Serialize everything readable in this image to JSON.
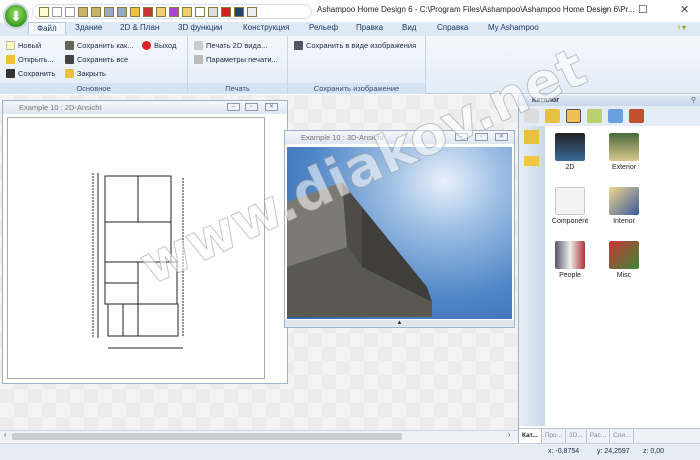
{
  "window": {
    "title": "Ashampoo Home Design 6 - C:\\Program Files\\Ashampoo\\Ashampoo Home Design 6\\Pr...",
    "minimize": "–",
    "maximize": "☐",
    "close": "✕"
  },
  "tabs": [
    "Файл",
    "Здание",
    "2D & План",
    "3D функции",
    "Конструкция",
    "Рельеф",
    "Правка",
    "Вид",
    "Справка",
    "My Ashampoo"
  ],
  "ribbon": {
    "groups": [
      {
        "label": "Основное",
        "items": [
          "Новый",
          "Открыть...",
          "Сохранить",
          "Сохранить как...",
          "Сохранить все",
          "Закрыть",
          "Выход"
        ]
      },
      {
        "label": "Печать",
        "items": [
          "Печать 2D вида...",
          "Параметры печати..."
        ]
      },
      {
        "label": "Сохранить изображение",
        "items": [
          "Сохранить в виде изображения"
        ]
      }
    ]
  },
  "windows": {
    "view2d": "Example 10 : 2D-Ansicht",
    "view3d": "Example 10 : 3D-Ansicht"
  },
  "catalog": {
    "title": "Каталог",
    "items": [
      "2D",
      "Exterior",
      "Component",
      "Interior",
      "People",
      "Misc"
    ],
    "tabs": [
      "Кат...",
      "Про...",
      "3D...",
      "Рас...",
      "Спи..."
    ]
  },
  "status": {
    "x": "x: -0,8754",
    "y": "y: 24,2597",
    "z": "z: 0,00"
  },
  "watermark": "www.diakov.net"
}
